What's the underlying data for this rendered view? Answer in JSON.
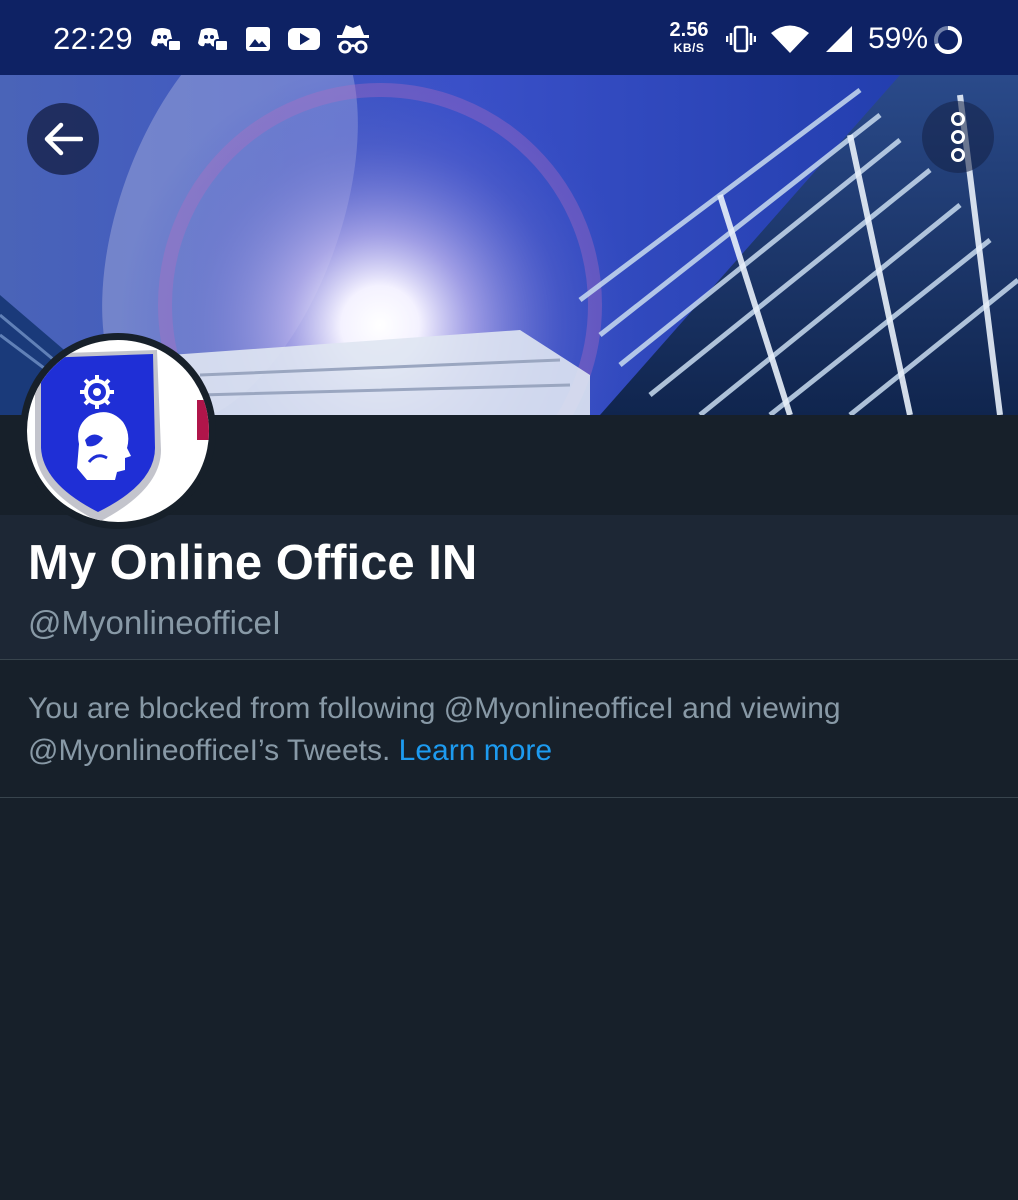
{
  "status_bar": {
    "time": "22:29",
    "net_speed_value": "2.56",
    "net_speed_unit": "KB/S",
    "battery_percent": "59%",
    "notification_icons": [
      "discord-icon",
      "discord-icon",
      "image-icon",
      "youtube-icon",
      "incognito-icon"
    ],
    "system_icons": [
      "vibrate-icon",
      "wifi-icon",
      "cellular-signal-icon",
      "battery-ring-icon"
    ],
    "background_color": "#0e2264"
  },
  "header": {
    "back_icon": "arrow-left-icon",
    "more_icon": "more-vertical-icon"
  },
  "profile": {
    "display_name": "My Online Office IN",
    "handle": "@MyonlineofficeI",
    "avatar_icon": "shield-head-gear-logo"
  },
  "blocked_notice": {
    "message": "You are blocked from following @MyonlineofficeI and viewing @MyonlineofficeI’s Tweets.",
    "learn_more": "Learn more",
    "link_color": "#1d9bf0"
  },
  "colors": {
    "page_background": "#17202a",
    "info_background": "#1d2735",
    "secondary_text": "#8899a6",
    "divider": "#38444d"
  }
}
